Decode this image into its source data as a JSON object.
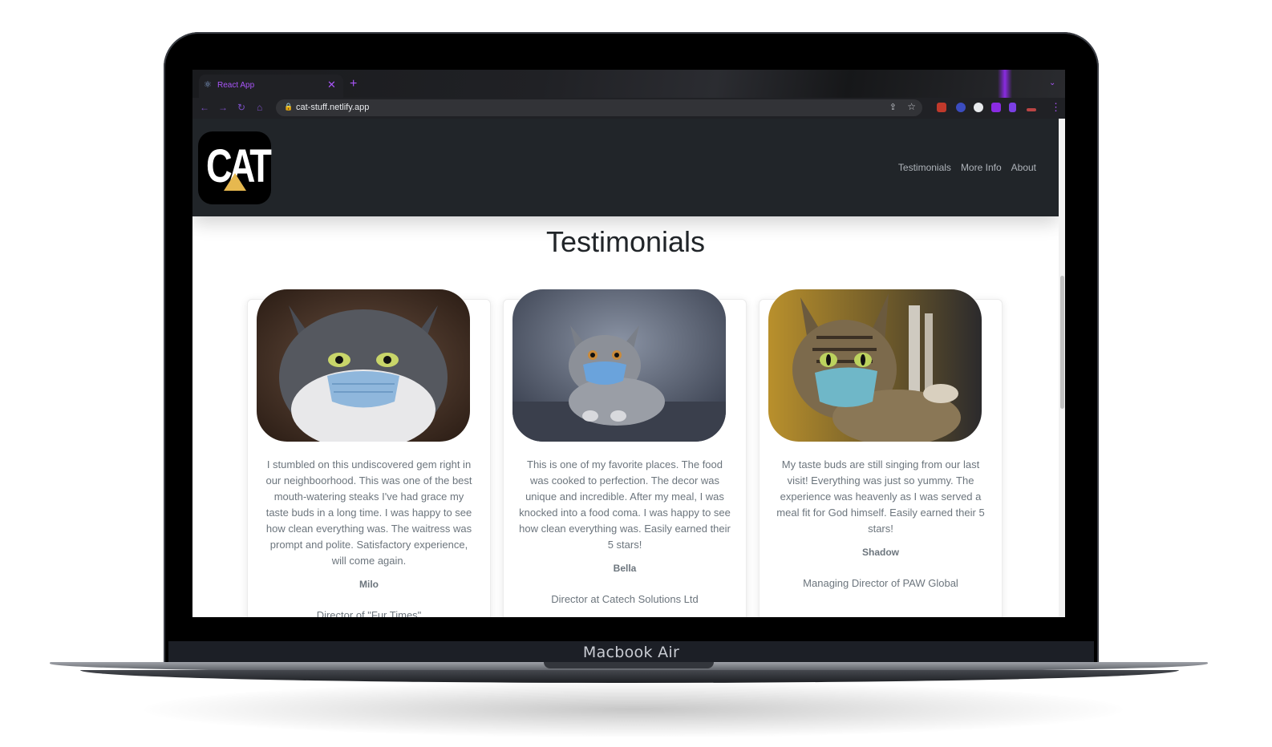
{
  "device": {
    "label": "Macbook Air"
  },
  "browser": {
    "tab_title": "React App",
    "tab_close": "✕",
    "new_tab": "+",
    "tab_menu": "⌄",
    "url": "cat-stuff.netlify.app",
    "icons": [
      "react-icon",
      "back-arrow-icon",
      "forward-arrow-icon",
      "reload-icon",
      "home-icon",
      "lock-icon",
      "share-icon",
      "star-icon",
      "extensions-icon",
      "sidepanel-icon",
      "kebab-menu-icon"
    ],
    "accent": "#a855f7"
  },
  "site": {
    "logo_text": "CAT",
    "nav": [
      "Testimonials",
      "More Info",
      "About"
    ],
    "page_title": "Testimonials",
    "colors": {
      "header_bg": "#212529",
      "logo_triangle": "#e6b84f",
      "text_muted": "#6c757d"
    }
  },
  "testimonials": [
    {
      "text": "I stumbled on this undiscovered gem right in our neighboorhood. This was one of the best mouth-watering steaks I've had grace my taste buds in a long time. I was happy to see how clean everything was. The waitress was prompt and polite. Satisfactory experience, will come again.",
      "name": "Milo",
      "role": "Director of \"Fur Times\""
    },
    {
      "text": "This is one of my favorite places. The food was cooked to perfection. The decor was unique and incredible. After my meal, I was knocked into a food coma. I was happy to see how clean everything was. Easily earned their 5 stars!",
      "name": "Bella",
      "role": "Director at Catech Solutions Ltd"
    },
    {
      "text": "My taste buds are still singing from our last visit! Everything was just so yummy. The experience was heavenly as I was served a meal fit for God himself. Easily earned their 5 stars!",
      "name": "Shadow",
      "role": "Managing Director of PAW Global"
    }
  ]
}
